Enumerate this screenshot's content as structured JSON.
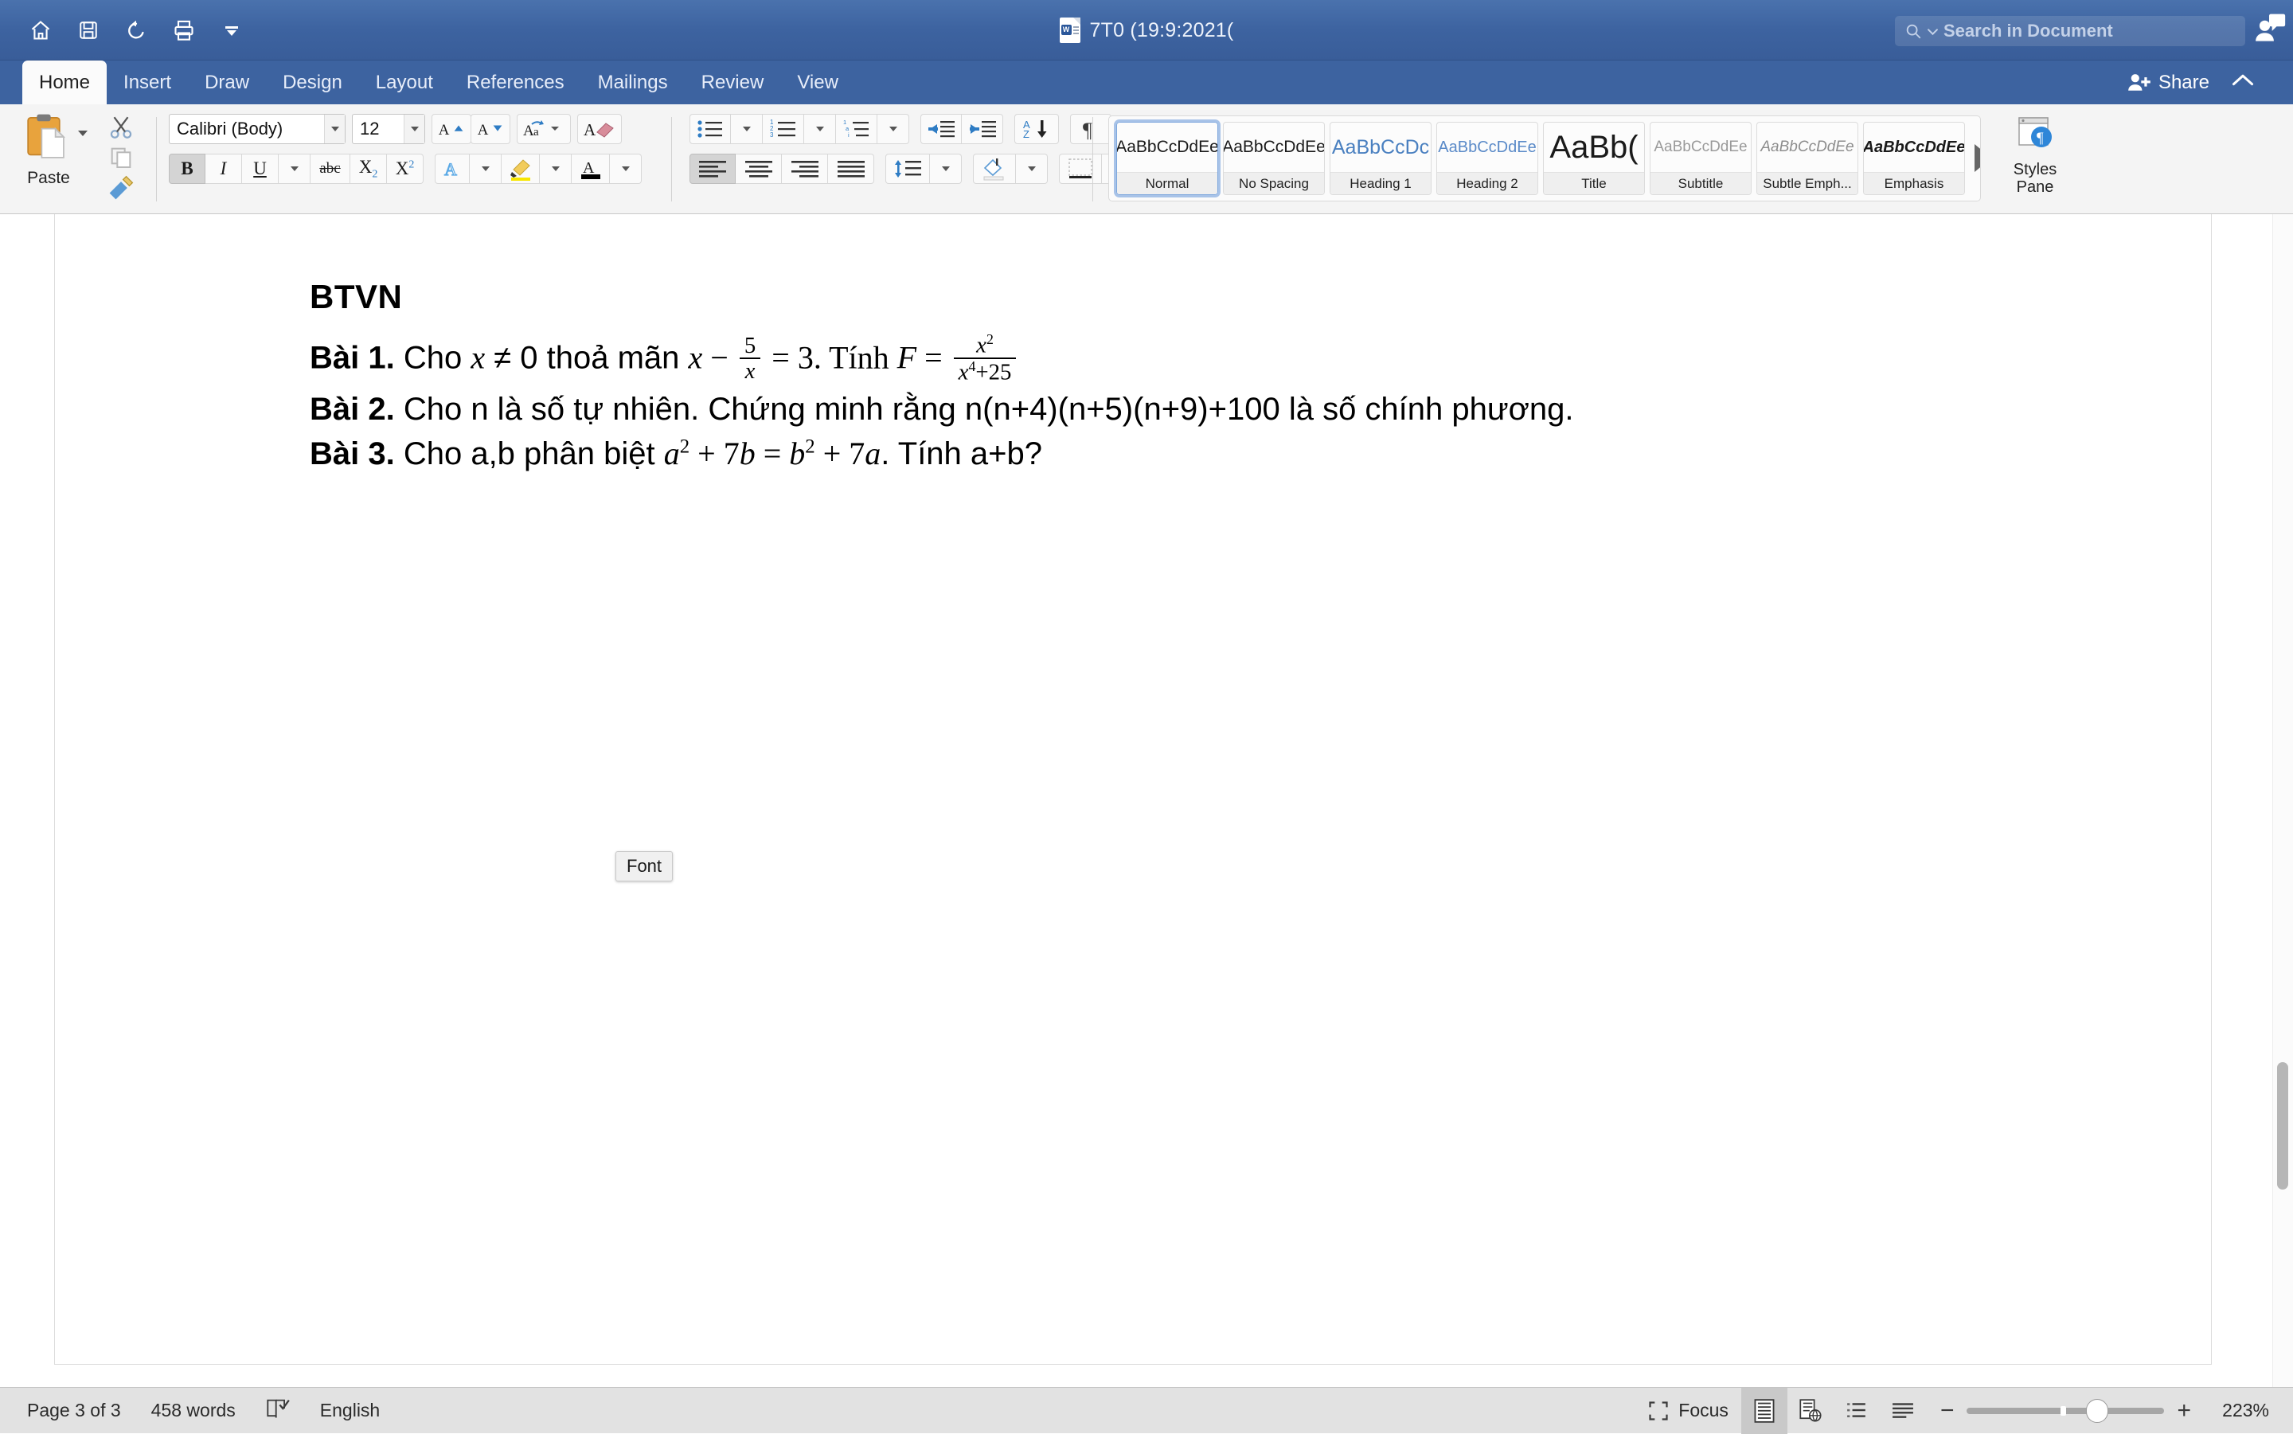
{
  "titlebar": {
    "quick_access": [
      {
        "name": "home-icon",
        "label": "Home"
      },
      {
        "name": "save-icon",
        "label": "Save"
      },
      {
        "name": "undo-icon",
        "label": "Undo"
      },
      {
        "name": "print-icon",
        "label": "Print"
      },
      {
        "name": "customize-toolbar-icon",
        "label": "Customize Toolbar"
      }
    ],
    "document_title": "7T0 (19:9:2021(",
    "search_placeholder": "Search in Document",
    "search_value": ""
  },
  "tabs": [
    {
      "label": "Home",
      "active": true
    },
    {
      "label": "Insert",
      "active": false
    },
    {
      "label": "Draw",
      "active": false
    },
    {
      "label": "Design",
      "active": false
    },
    {
      "label": "Layout",
      "active": false
    },
    {
      "label": "References",
      "active": false
    },
    {
      "label": "Mailings",
      "active": false
    },
    {
      "label": "Review",
      "active": false
    },
    {
      "label": "View",
      "active": false
    }
  ],
  "share": {
    "label": "Share"
  },
  "ribbon": {
    "clipboard": {
      "paste_label": "Paste"
    },
    "font": {
      "font_name": "Calibri (Body)",
      "font_size": "12",
      "bold": "B",
      "italic": "I",
      "underline": "U",
      "strikethrough": "abc",
      "subscript": "X",
      "subscript_n": "2",
      "superscript": "X",
      "superscript_n": "2",
      "bold_active": true
    },
    "styles": [
      {
        "preview": "AaBbCcDdEe",
        "name": "Normal",
        "selected": true,
        "kind": "normal"
      },
      {
        "preview": "AaBbCcDdEe",
        "name": "No Spacing",
        "selected": false,
        "kind": "nospacing"
      },
      {
        "preview": "AaBbCcDc",
        "name": "Heading 1",
        "selected": false,
        "kind": "h1"
      },
      {
        "preview": "AaBbCcDdEe",
        "name": "Heading 2",
        "selected": false,
        "kind": "h2"
      },
      {
        "preview": "AaBb(",
        "name": "Title",
        "selected": false,
        "kind": "title"
      },
      {
        "preview": "AaBbCcDdEe",
        "name": "Subtitle",
        "selected": false,
        "kind": "subtitle"
      },
      {
        "preview": "AaBbCcDdEe",
        "name": "Subtle Emph...",
        "selected": false,
        "kind": "subtle"
      },
      {
        "preview": "AaBbCcDdEe",
        "name": "Emphasis",
        "selected": false,
        "kind": "emphasis"
      }
    ],
    "styles_pane": {
      "line1": "Styles",
      "line2": "Pane"
    }
  },
  "document": {
    "heading": "BTVN",
    "lines": [
      {
        "label": "Bài 1.",
        "text_1": " Cho ",
        "math_x": "x",
        "text_2": " ≠  0 thoả mãn ",
        "math_x2": "x",
        "minus": " − ",
        "frac1_num": "5",
        "frac1_den": "x",
        "eq": " = 3. Tính ",
        "math_F": "F",
        "eq2": " = ",
        "frac2_num": "x",
        "frac2_num_sup": "2",
        "frac2_den": "x",
        "frac2_den_sup": "4",
        "frac2_den_rest": "+25"
      },
      {
        "label": "Bài 2.",
        "text": " Cho n là số tự nhiên. Chứng minh rằng n(n+4)(n+5)(n+9)+100 là số chính phương."
      },
      {
        "label": "Bài 3.",
        "text_1": " Cho a,b phân biệt ",
        "m_a": "a",
        "m_a_sup": "2",
        "m_plus": " + 7",
        "m_b": "b",
        "m_eq": " = ",
        "m_b2": "b",
        "m_b2_sup": "2",
        "m_plus2": " + 7",
        "m_a2": "a",
        "text_2": ". Tính a+b?"
      }
    ],
    "tooltip": "Font"
  },
  "statusbar": {
    "page": "Page 3 of 3",
    "words": "458 words",
    "language": "English",
    "focus": "Focus",
    "zoom": "223%"
  }
}
